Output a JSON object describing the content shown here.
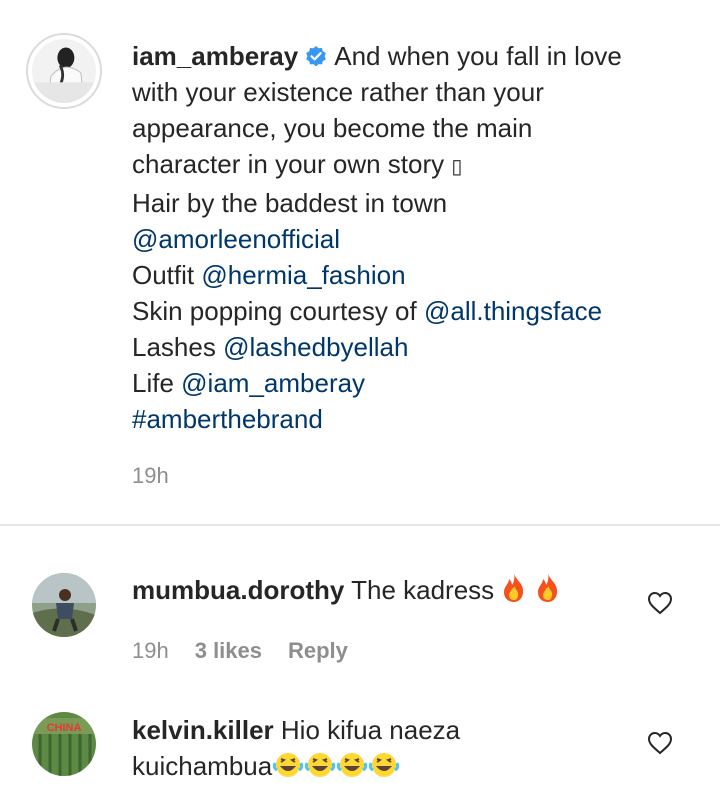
{
  "post": {
    "username": "iam_amberay",
    "caption_lines": [
      "And when you fall in love",
      "with your existence rather than your",
      "appearance, you become the main",
      "character in your own story ",
      "Hair by the baddest in town",
      "@amorleenofficial",
      "Outfit ",
      "@hermia_fashion",
      "Skin popping courtesy of ",
      "@all.thingsface",
      "Lashes ",
      "@lashedbyellah",
      "Life ",
      "@iam_amberay",
      "#amberthebrand"
    ],
    "missing_glyph": "▯",
    "time": "19h"
  },
  "comments": [
    {
      "username": "mumbua.dorothy",
      "text": "The kadress",
      "time": "19h",
      "likes": "3 likes",
      "reply": "Reply"
    },
    {
      "username": "kelvin.killer",
      "text_line1": "Hio kifua naeza",
      "text_line2": "kuichambua",
      "avatar_text": "CHINA"
    }
  ],
  "colors": {
    "text": "#262626",
    "link": "#00376b",
    "muted": "#8e8e8e",
    "verified": "#3897f0"
  }
}
